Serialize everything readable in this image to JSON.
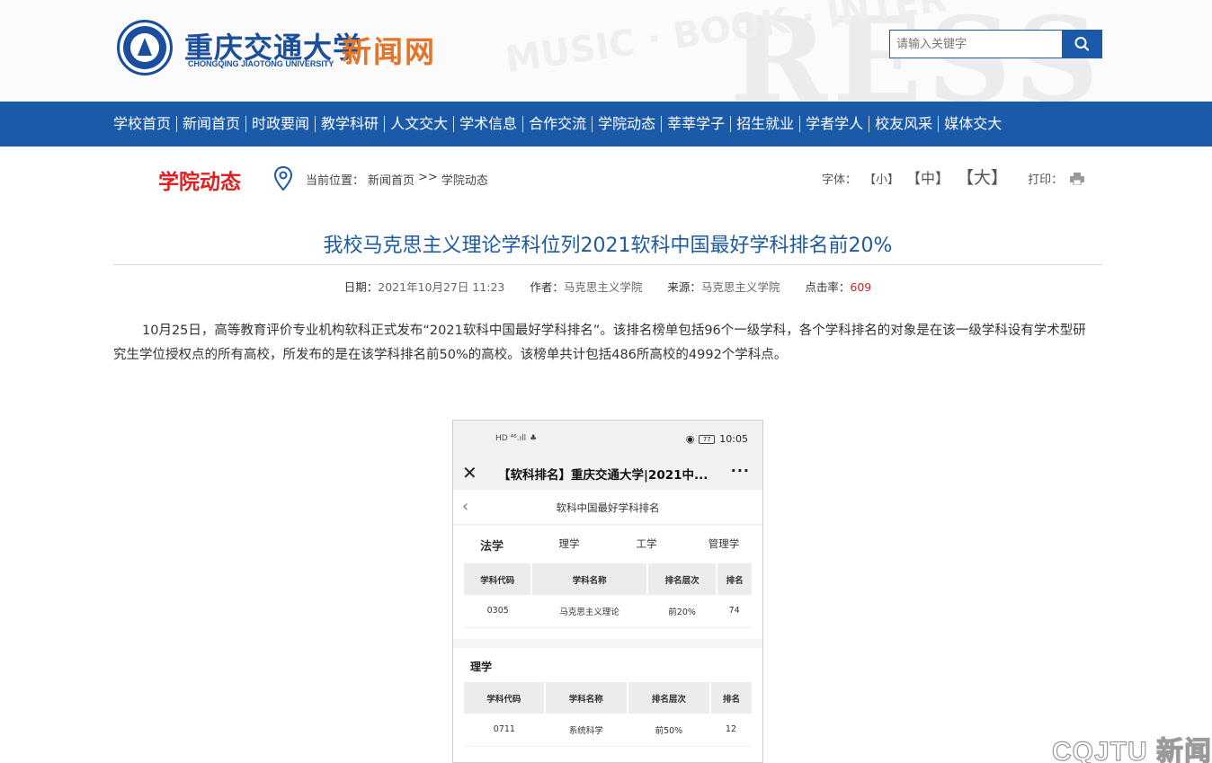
{
  "header": {
    "logo_cn": "重庆交通大学",
    "logo_en": "CHONGQING JIAOTONG UNIVERSITY",
    "site_name": "新闻网",
    "search_placeholder": "请输入关键字"
  },
  "nav": {
    "items": [
      "学校首页",
      "新闻首页",
      "时政要闻",
      "教学科研",
      "人文交大",
      "学术信息",
      "合作交流",
      "学院动态",
      "莘莘学子",
      "招生就业",
      "学者学人",
      "校友风采",
      "媒体交大"
    ]
  },
  "section": {
    "title": "学院动态",
    "location_label": "当前位置：",
    "crumbs": [
      "新闻首页",
      ">>",
      "学院动态"
    ],
    "font_label": "字体：",
    "font_small": "【小】",
    "font_medium": "【中】",
    "font_large": "【大】",
    "print_label": "打印："
  },
  "article": {
    "title": "我校马克思主义理论学科位列2021软科中国最好学科排名前20%",
    "date_label": "日期：",
    "date": "2021年10月27日 11:23",
    "author_label": "作者：",
    "author": "马克思主义学院",
    "source_label": "来源：",
    "source": "马克思主义学院",
    "hits_label": "点击率：",
    "hits": "609",
    "paragraph": "10月25日，高等教育评价专业机构软科正式发布“2021软科中国最好学科排名”。该排名榜单包括96个一级学科，各个学科排名的对象是在该一级学科设有学术型研究生学位授权点的所有高校，所发布的是在该学科排名前50%的高校。该榜单共计包括486所高校的4992个学科点。"
  },
  "phone": {
    "status_left": "HD ⁴⁶.ıll",
    "battery": "77",
    "time": "10:05",
    "wx_close": "✕",
    "wx_title": "【软科排名】重庆交通大学|2021中...",
    "wx_more": "···",
    "page_back": "‹",
    "page_title": "软科中国最好学科排名",
    "tabs": [
      "法学",
      "理学",
      "工学",
      "管理学"
    ],
    "table_headers": [
      "学科代码",
      "学科名称",
      "排名层次",
      "排名"
    ],
    "table1": {
      "code": "0305",
      "name": "马克思主义理论",
      "level": "前20%",
      "rank": "74"
    },
    "section2_title": "理学",
    "table2": {
      "code": "0711",
      "name": "系统科学",
      "level": "前50%",
      "rank": "12"
    }
  },
  "watermark": "CQJTU 新闻",
  "colors": {
    "brand_blue": "#1b5aa8",
    "section_red": "#e02020",
    "title_blue": "#1e5a9e",
    "accent_orange": "#e17529"
  }
}
